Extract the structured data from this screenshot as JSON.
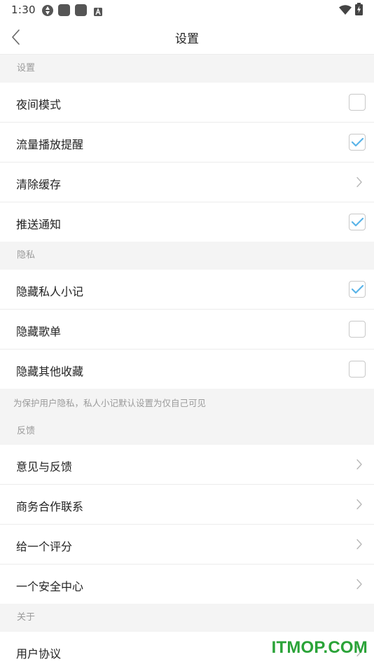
{
  "status_bar": {
    "time": "1:30",
    "icons": [
      "sync-icon",
      "app-icon",
      "app-icon",
      "text-a-icon",
      "wifi-icon",
      "battery-charging-icon"
    ]
  },
  "header": {
    "back_icon": "chevron-left-icon",
    "title": "设置"
  },
  "sections": {
    "settings": {
      "title": "设置",
      "items": [
        {
          "label": "夜间模式",
          "control": "checkbox",
          "checked": false
        },
        {
          "label": "流量播放提醒",
          "control": "checkbox",
          "checked": true
        },
        {
          "label": "清除缓存",
          "control": "chevron"
        },
        {
          "label": "推送通知",
          "control": "checkbox",
          "checked": true
        }
      ]
    },
    "privacy": {
      "title": "隐私",
      "items": [
        {
          "label": "隐藏私人小记",
          "control": "checkbox",
          "checked": true
        },
        {
          "label": "隐藏歌单",
          "control": "checkbox",
          "checked": false
        },
        {
          "label": "隐藏其他收藏",
          "control": "checkbox",
          "checked": false
        }
      ],
      "note": "为保护用户隐私，私人小记默认设置为仅自己可见"
    },
    "feedback": {
      "title": "反馈",
      "items": [
        {
          "label": "意见与反馈",
          "control": "chevron"
        },
        {
          "label": "商务合作联系",
          "control": "chevron"
        },
        {
          "label": "给一个评分",
          "control": "chevron"
        },
        {
          "label": "一个安全中心",
          "control": "chevron"
        }
      ]
    },
    "about": {
      "title": "关于",
      "items": [
        {
          "label": "用户协议",
          "control": "chevron"
        }
      ]
    }
  },
  "watermark": "ITMOP.COM",
  "colors": {
    "accent_check": "#5ab4e8",
    "section_bg": "#f4f4f4",
    "watermark": "#2aa338"
  }
}
